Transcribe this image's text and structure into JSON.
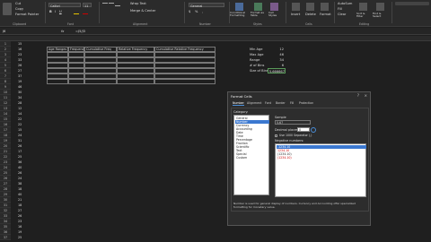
{
  "ribbon": {
    "clipboard": {
      "cut": "Cut",
      "copy": "Copy",
      "format_painter": "Format Painter"
    },
    "font": {
      "name": "Calibri",
      "size": "11"
    },
    "alignment": {
      "wrap_text": "Wrap Text",
      "merge_center": "Merge & Center"
    },
    "number": {
      "format": "General"
    },
    "styles": {
      "conditional_formatting": "Conditional Formatting",
      "format_as_table": "Format as Table",
      "cell_styles": "Cell Styles"
    },
    "cells": {
      "insert": "Insert",
      "delete": "Delete",
      "format": "Format"
    },
    "editing": {
      "autosum": "AutoSum",
      "fill": "Fill",
      "clear": "Clear",
      "sort_filter": "Sort & Filter",
      "find_select": "Find & Select"
    },
    "group_labels": [
      "Clipboard",
      "Font",
      "Alignment",
      "Number",
      "Styles",
      "Cells",
      "Editing"
    ]
  },
  "formula_bar": {
    "name_box": "J6",
    "fx": "fx",
    "value": "=J5/J3"
  },
  "rows": [
    "1",
    "2",
    "3",
    "4",
    "5",
    "6",
    "7",
    "8",
    "9",
    "10",
    "11",
    "12",
    "13",
    "14",
    "15",
    "16",
    "17",
    "18",
    "19",
    "20",
    "21",
    "22",
    "23",
    "24",
    "25",
    "26",
    "27",
    "28",
    "29",
    "30",
    "31",
    "32",
    "33",
    "34",
    "35",
    "36",
    "37"
  ],
  "col_a_values": [
    "15",
    "16",
    "23",
    "33",
    "26",
    "27",
    "37",
    "19",
    "46",
    "30",
    "34",
    "28",
    "12",
    "14",
    "22",
    "22",
    "15",
    "24",
    "31",
    "26",
    "17",
    "25",
    "36",
    "40",
    "26",
    "24",
    "38",
    "18",
    "40",
    "21",
    "18",
    "27",
    "26",
    "23",
    "16",
    "19",
    "25"
  ],
  "table_headers": [
    "Age Ranges",
    "Frequency",
    "Cumulative Freq",
    "Relative Frequency",
    "Cumulative Relative Frequency"
  ],
  "stats": [
    {
      "label": "Min Age",
      "value": "12"
    },
    {
      "label": "Max Age",
      "value": "46"
    },
    {
      "label": "Range",
      "value": "34"
    },
    {
      "label": "# of Bins",
      "value": "6"
    },
    {
      "label": "Size of Bins",
      "value": "5.666667"
    }
  ],
  "dialog": {
    "title": "Format Cells",
    "close": "×",
    "help": "?",
    "tabs": [
      "Number",
      "Alignment",
      "Font",
      "Border",
      "Fill",
      "Protection"
    ],
    "category_label": "Category:",
    "categories": [
      "General",
      "Number",
      "Currency",
      "Accounting",
      "Date",
      "Time",
      "Percentage",
      "Fraction",
      "Scientific",
      "Text",
      "Special",
      "Custom"
    ],
    "selected_category": "Number",
    "sample_label": "Sample",
    "sample_value": "5.67",
    "decimal_label": "Decimal places:",
    "decimal_value": "0",
    "separator_label": "Use 1000 Separator (,)",
    "negative_label": "Negative numbers:",
    "negative_options": [
      "-1234.10",
      "1234.10",
      "(1234.10)",
      "(1234.10)"
    ],
    "description": "Number is used for general display of numbers. Currency and Accounting offer specialized formatting for monetary value."
  },
  "colors": {
    "ribbon_bg": "#2b2b2b",
    "sheet_bg": "#1f1f1f",
    "accent": "#3b78d0"
  }
}
